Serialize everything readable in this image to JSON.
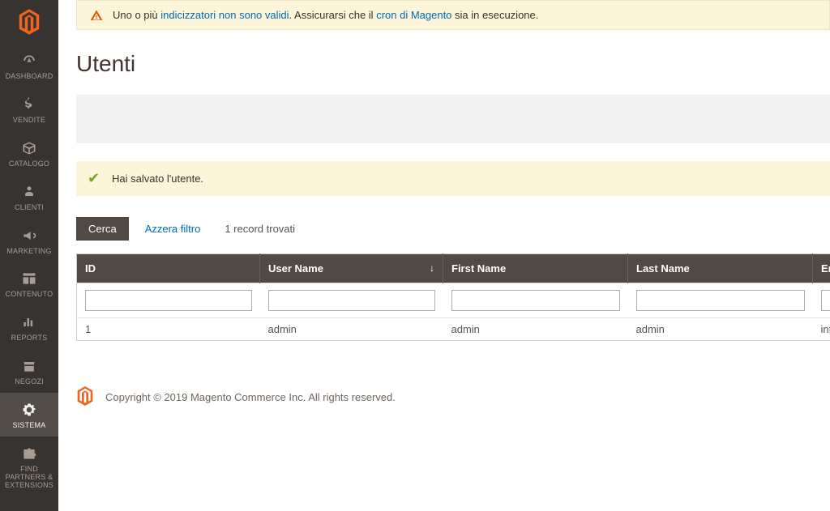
{
  "sidebar": {
    "items": [
      {
        "label": "DASHBOARD"
      },
      {
        "label": "VENDITE"
      },
      {
        "label": "CATALOGO"
      },
      {
        "label": "CLIENTI"
      },
      {
        "label": "MARKETING"
      },
      {
        "label": "CONTENUTO"
      },
      {
        "label": "REPORTS"
      },
      {
        "label": "NEGOZI"
      },
      {
        "label": "SISTEMA"
      },
      {
        "label": "FIND PARTNERS & EXTENSIONS"
      }
    ]
  },
  "alert": {
    "t1": "Uno o più ",
    "link1": "indicizzatori non sono validi",
    "t2": ". Assicurarsi che il ",
    "link2": "cron di Magento",
    "t3": " sia in esecuzione."
  },
  "page": {
    "title": "Utenti"
  },
  "success": {
    "text": "Hai salvato l'utente."
  },
  "controls": {
    "search": "Cerca",
    "reset": "Azzera filtro",
    "count": "1 record trovati"
  },
  "grid": {
    "headers": {
      "id": "ID",
      "username": "User Name",
      "firstname": "First Name",
      "lastname": "Last Name",
      "email": "Em"
    },
    "rows": [
      {
        "id": "1",
        "username": "admin",
        "firstname": "admin",
        "lastname": "admin",
        "email": "inf"
      }
    ]
  },
  "footer": {
    "copyright": "Copyright © 2019 Magento Commerce Inc. All rights reserved."
  },
  "colors": {
    "brand_orange": "#f2631e",
    "accent_link": "#006bb4",
    "sidebar_bg": "#373330"
  }
}
